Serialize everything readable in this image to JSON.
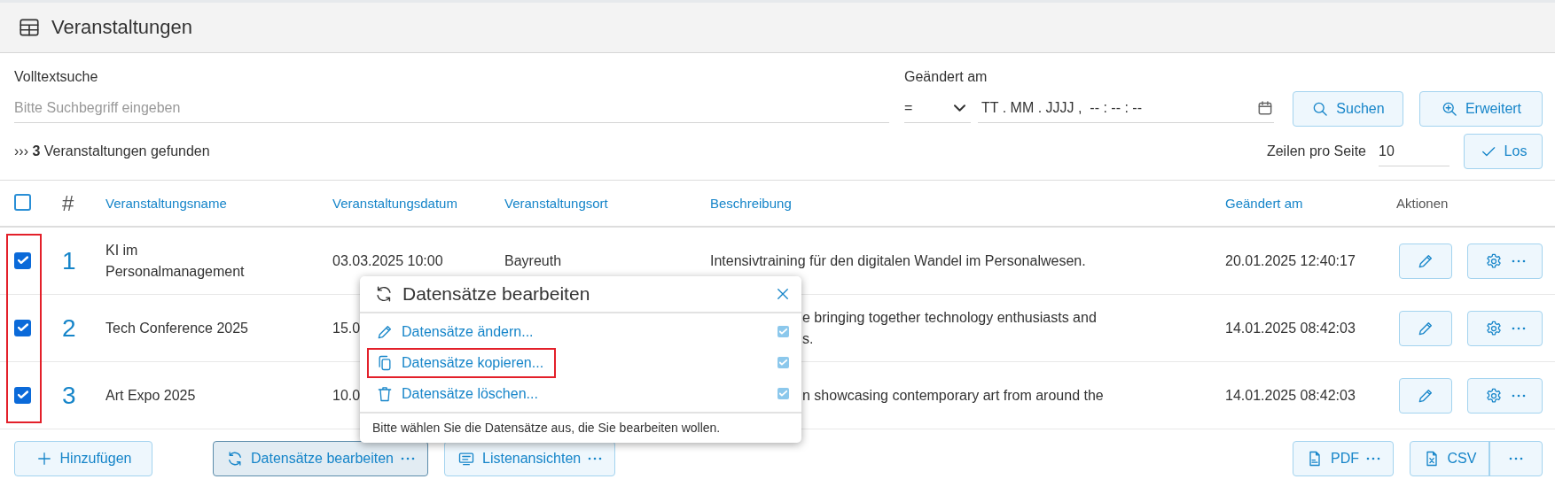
{
  "header": {
    "title": "Veranstaltungen"
  },
  "search": {
    "label": "Volltextsuche",
    "placeholder": "Bitte Suchbegriff eingeben"
  },
  "changed_filter": {
    "label": "Geändert am",
    "operator": "=",
    "placeholder": "TT . MM . JJJJ ,  -- : -- : --"
  },
  "filter_buttons": [
    {
      "label": "Suchen"
    },
    {
      "label": "Erweitert"
    }
  ],
  "result_summary": "››› **3** Veranstaltungen gefunden",
  "page_size": {
    "label": "Zeilen pro Seite",
    "value": "10",
    "button": "Los"
  },
  "table": {
    "select_all_checked": false,
    "checkbox_column_highlighted": true,
    "columns": [
      {
        "label": "#",
        "sortable": false
      },
      {
        "label": "Veranstaltungsname",
        "sortable": true
      },
      {
        "label": "Veranstaltungsdatum",
        "sortable": true
      },
      {
        "label": "Veranstaltungsort",
        "sortable": true
      },
      {
        "label": "Beschreibung",
        "sortable": true
      },
      {
        "label": "Geändert am",
        "sortable": true
      },
      {
        "label": "Aktionen",
        "sortable": false
      }
    ],
    "rows": [
      {
        "checked": true,
        "number": "1",
        "name": "KI im Personalmanagement",
        "date": "03.03.2025 10:00",
        "place": "Bayreuth",
        "description": [
          "Intensivtraining für den digitalen Wandel im Personalwesen."
        ],
        "description_clipped": false,
        "changed": "20.01.2025 12:40:17"
      },
      {
        "checked": true,
        "number": "2",
        "name": "Tech Conference 2025",
        "date": "15.0",
        "description": [
          "e bringing together technology enthusiasts and",
          "s."
        ],
        "description_clipped": true,
        "changed": "14.01.2025 08:42:03"
      },
      {
        "checked": true,
        "number": "3",
        "name": "Art Expo 2025",
        "date": "10.0",
        "description": [
          "n showcasing contemporary art from around the"
        ],
        "description_clipped": true,
        "changed": "14.01.2025 08:42:03"
      }
    ]
  },
  "popup": {
    "title": "Datensätze bearbeiten",
    "items": [
      {
        "label": "Datensätze ändern...",
        "checked": true,
        "highlighted": false
      },
      {
        "label": "Datensätze kopieren...",
        "checked": true,
        "highlighted": true
      },
      {
        "label": "Datensätze löschen...",
        "checked": true,
        "highlighted": false
      }
    ],
    "hint": "Bitte wählen Sie die Datensätze aus, die Sie bearbeiten wollen."
  },
  "footer_buttons": [
    {
      "label": "Hinzufügen",
      "kind": "plain",
      "pressed": false
    },
    {
      "label": "Datensätze bearbeiten",
      "kind": "menu",
      "pressed": true
    },
    {
      "label": "Listenansichten",
      "kind": "menu",
      "pressed": false
    },
    {
      "label": "PDF",
      "kind": "menu",
      "pressed": false
    },
    {
      "label": "CSV",
      "kind": "split",
      "pressed": false
    }
  ]
}
